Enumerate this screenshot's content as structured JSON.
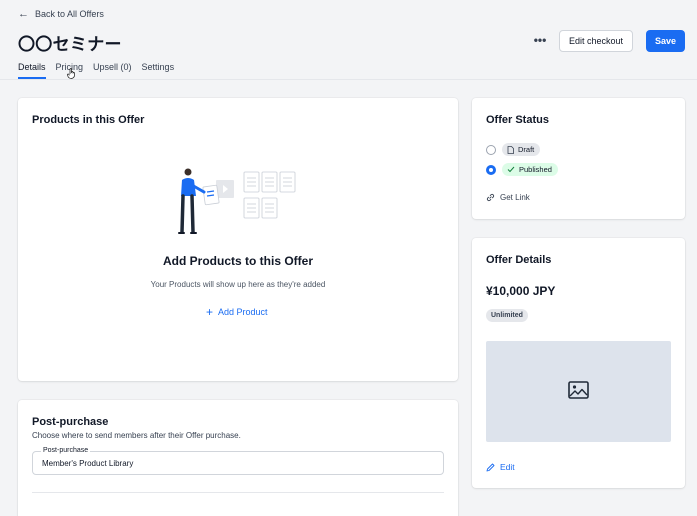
{
  "header": {
    "back_label": "Back to All Offers",
    "title": "〇〇セミナー",
    "more_label": "•••",
    "edit_checkout_label": "Edit checkout",
    "save_label": "Save"
  },
  "tabs": [
    {
      "label": "Details",
      "active": true
    },
    {
      "label": "Pricing",
      "active": false
    },
    {
      "label": "Upsell (0)",
      "active": false
    },
    {
      "label": "Settings",
      "active": false
    }
  ],
  "products_card": {
    "title": "Products in this Offer",
    "empty_title": "Add Products to this Offer",
    "empty_subtitle": "Your Products will show up here as they're added",
    "add_label": "Add Product"
  },
  "post_purchase": {
    "title": "Post-purchase",
    "subtitle": "Choose where to send members after their Offer purchase.",
    "field_label": "Post-purchase",
    "field_value": "Member's Product Library"
  },
  "offer_status": {
    "title": "Offer Status",
    "options": [
      {
        "label": "Draft",
        "checked": false
      },
      {
        "label": "Published",
        "checked": true
      }
    ],
    "get_link_label": "Get Link"
  },
  "offer_details": {
    "title": "Offer Details",
    "price": "¥10,000 JPY",
    "badge": "Unlimited",
    "edit_label": "Edit"
  },
  "colors": {
    "accent": "#1a6cf2",
    "published_chip": "#dcfce7",
    "draft_chip": "#e5e7eb",
    "background": "#f3f4f6"
  }
}
